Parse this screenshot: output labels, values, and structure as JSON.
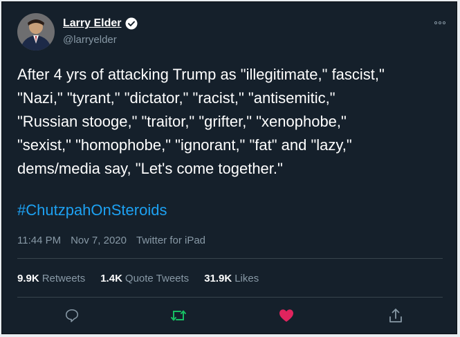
{
  "user": {
    "name": "Larry Elder",
    "handle": "@larryelder"
  },
  "tweet": {
    "text": "After 4 yrs of attacking Trump as \"illegitimate,\" fascist,\"\n\"Nazi,\" \"tyrant,\" \"dictator,\" \"racist,\" \"antisemitic,\"\n\"Russian stooge,\" \"traitor,\" \"grifter,\" \"xenophobe,\"\n\"sexist,\" \"homophobe,\" \"ignorant,\" \"fat\" and \"lazy,\"\ndems/media say, \"Let's come together.\"",
    "hashtag": "#ChutzpahOnSteroids"
  },
  "meta": {
    "time": "11:44 PM",
    "date": "Nov 7, 2020",
    "source": "Twitter for iPad"
  },
  "stats": {
    "retweets_count": "9.9K",
    "retweets_label": "Retweets",
    "quotes_count": "1.4K",
    "quotes_label": "Quote Tweets",
    "likes_count": "31.9K",
    "likes_label": "Likes"
  },
  "icons": {
    "more": "more-icon",
    "verified": "verified-badge-icon",
    "reply": "reply-icon",
    "retweet": "retweet-icon",
    "like": "heart-icon",
    "share": "share-icon"
  },
  "colors": {
    "background": "#15202b",
    "accent": "#1da1f2",
    "retweet": "#17bf63",
    "like": "#e0245e",
    "muted": "#8899a6"
  }
}
